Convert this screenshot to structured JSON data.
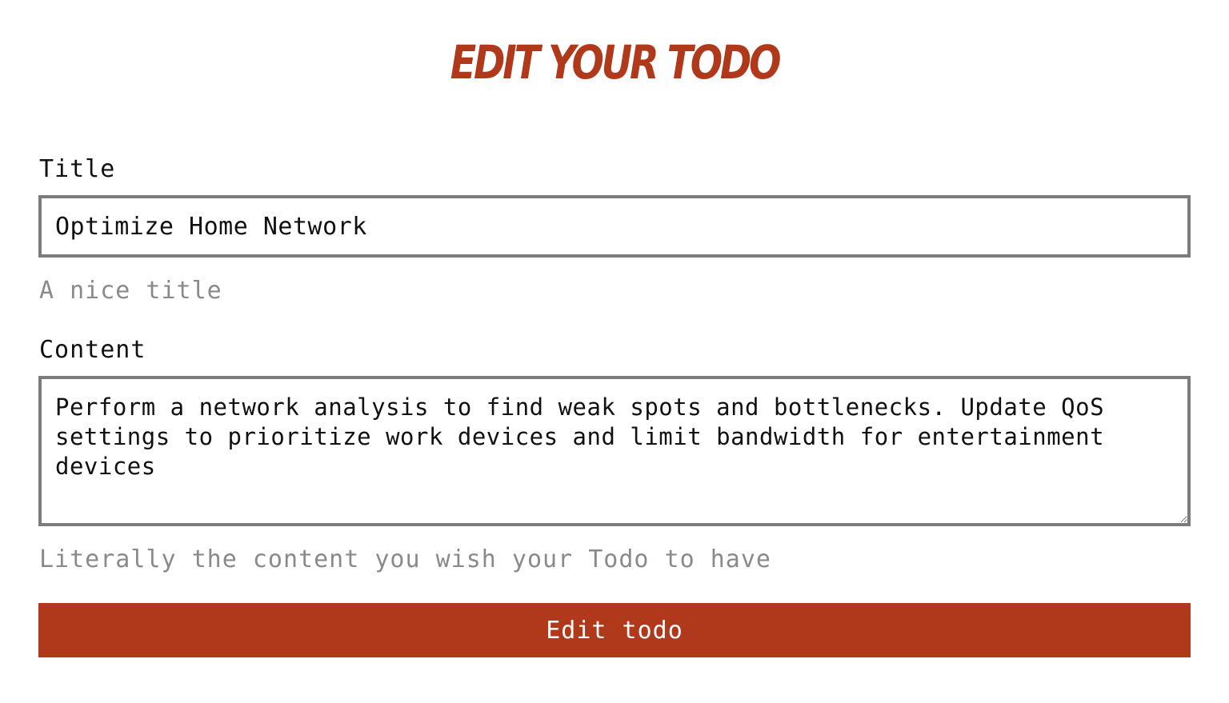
{
  "page": {
    "heading": "Edit your Todo"
  },
  "form": {
    "title_field": {
      "label": "Title",
      "value": "Optimize Home Network",
      "help": "A nice title"
    },
    "content_field": {
      "label": "Content",
      "value": "Perform a network analysis to find weak spots and bottlenecks. Update QoS settings to prioritize work devices and limit bandwidth for entertainment devices",
      "help": "Literally the content you wish your Todo to have"
    },
    "submit_label": "Edit todo"
  },
  "colors": {
    "accent": "#b0391b",
    "border": "#7c7c7c",
    "help_text": "#8a8a8a"
  }
}
